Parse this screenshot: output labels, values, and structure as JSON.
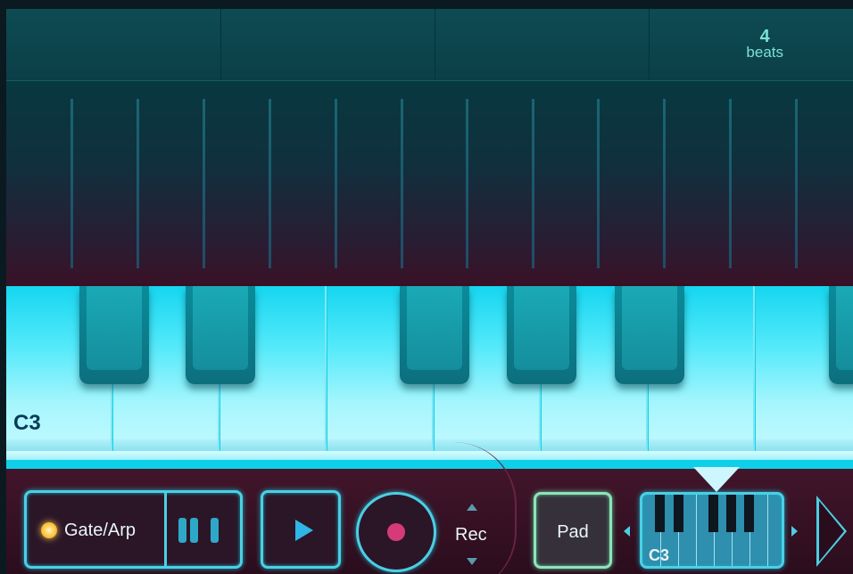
{
  "header": {
    "beats_value": "4",
    "beats_unit": "beats"
  },
  "keyboard": {
    "octave_label": "C3"
  },
  "controls": {
    "gate_arp_label": "Gate/Arp",
    "rec_label": "Rec",
    "pad_label": "Pad",
    "mini_keyboard_label": "C3"
  },
  "colors": {
    "accent": "#4ccfe3",
    "record": "#d63a7a",
    "gate_light": "#ffc53d",
    "pad_border": "#8fe3b8"
  },
  "icons": [
    "play-icon",
    "record-icon",
    "arrow-up-icon",
    "arrow-down-icon",
    "gate-light-icon",
    "chevron-left-icon",
    "chevron-right-icon",
    "next-arrow-icon"
  ]
}
